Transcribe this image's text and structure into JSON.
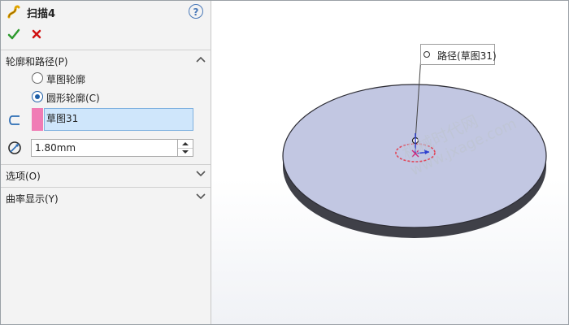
{
  "title": "扫描4",
  "help_label": "?",
  "sections": {
    "profile_path": "轮廓和路径(P)",
    "options": "选项(O)",
    "curvature": "曲率显示(Y)"
  },
  "profile_options": [
    {
      "label": "草图轮廓",
      "checked": false
    },
    {
      "label": "圆形轮廓(C)",
      "checked": true
    }
  ],
  "path_selection": "草图31",
  "diameter_value": "1.80mm",
  "callout_label": "路径(草图31)",
  "watermark": {
    "line1": "机械时代网",
    "line2": "www.jxage.com"
  },
  "colors": {
    "accent": "#1e5fa8",
    "profile_swatch": "#f07cb5",
    "selection_bg": "#cfe6fb",
    "disk_face": "#c2c7e2",
    "disk_side": "#3f4048",
    "path_circle": "#e0485a"
  }
}
